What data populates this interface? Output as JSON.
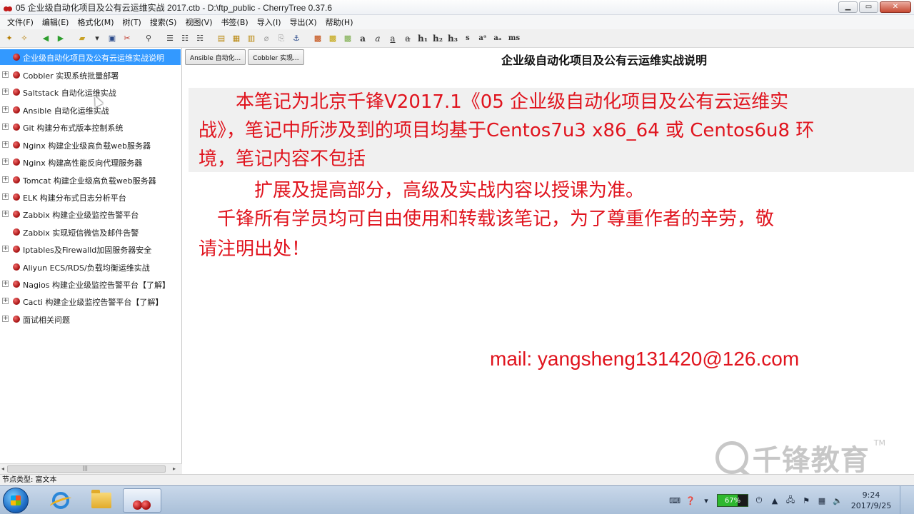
{
  "window": {
    "title": "05 企业级自动化项目及公有云运维实战 2017.ctb - D:\\ftp_public - CherryTree 0.37.6",
    "minimize": "▁",
    "maximize": "▭",
    "close": "✕"
  },
  "menu": {
    "items": [
      "文件(F)",
      "编辑(E)",
      "格式化(M)",
      "树(T)",
      "搜索(S)",
      "视图(V)",
      "书签(B)",
      "导入(I)",
      "导出(X)",
      "帮助(H)"
    ]
  },
  "toolbar": {
    "text_buttons": [
      "a",
      "a",
      "a",
      "a",
      "h₁",
      "h₂",
      "h₃",
      "s",
      "aᵃ",
      "aₐ",
      "ms"
    ]
  },
  "tree": {
    "items": [
      {
        "label": "企业级自动化项目及公有云运维实战说明",
        "expander": false,
        "selected": true
      },
      {
        "label": "Cobbler 实现系统批量部署",
        "expander": true,
        "selected": false
      },
      {
        "label": "Saltstack 自动化运维实战",
        "expander": true,
        "selected": false
      },
      {
        "label": "Ansible 自动化运维实战",
        "expander": true,
        "selected": false
      },
      {
        "label": "Git 构建分布式版本控制系统",
        "expander": true,
        "selected": false
      },
      {
        "label": "Nginx 构建企业级高负载web服务器",
        "expander": true,
        "selected": false
      },
      {
        "label": "Nginx 构建高性能反向代理服务器",
        "expander": true,
        "selected": false
      },
      {
        "label": "Tomcat 构建企业级高负载web服务器",
        "expander": true,
        "selected": false
      },
      {
        "label": "ELK 构建分布式日志分析平台",
        "expander": true,
        "selected": false
      },
      {
        "label": "Zabbix 构建企业级监控告警平台",
        "expander": true,
        "selected": false
      },
      {
        "label": "Zabbix 实现短信微信及邮件告警",
        "expander": false,
        "selected": false
      },
      {
        "label": "Iptables及Firewalld加固服务器安全",
        "expander": true,
        "selected": false
      },
      {
        "label": "Aliyun ECS/RDS/负载均衡运维实战",
        "expander": false,
        "selected": false
      },
      {
        "label": "Nagios 构建企业级监控告警平台【了解】",
        "expander": true,
        "selected": false
      },
      {
        "label": "Cacti 构建企业级监控告警平台【了解】",
        "expander": true,
        "selected": false
      },
      {
        "label": "面试相关问题",
        "expander": true,
        "selected": false
      }
    ],
    "scroll_left": "◂",
    "scroll_right": "▸",
    "scroll_grip": "|||"
  },
  "content": {
    "tabs": [
      "Ansible 自动化...",
      "Cobbler 实现..."
    ],
    "node_title": "企业级自动化项目及公有云运维实战说明",
    "lines": [
      "　　本笔记为北京千锋V2017.1《05 企业级自动化项目及公有云运维实",
      "战》，笔记中所涉及到的项目均基于Centos7u3 x86_64 或 Centos6u8 环",
      "境，笔记内容不包括",
      "　　　扩展及提高部分，高级及实战内容以授课为准。",
      "　千锋所有学员均可自由使用和转载该笔记，为了尊重作者的辛劳，敬",
      "请注明出处！"
    ],
    "mail": "mail:  yangsheng131420@126.com",
    "watermark": "千锋教育",
    "watermark_tm": "TM"
  },
  "status": {
    "text": "节点类型: 富文本"
  },
  "taskbar": {
    "battery": "67%",
    "time": "9:24",
    "date": "2017/9/25"
  },
  "colors": {
    "accent_text": "#e0141e",
    "selection": "#3399ff"
  }
}
